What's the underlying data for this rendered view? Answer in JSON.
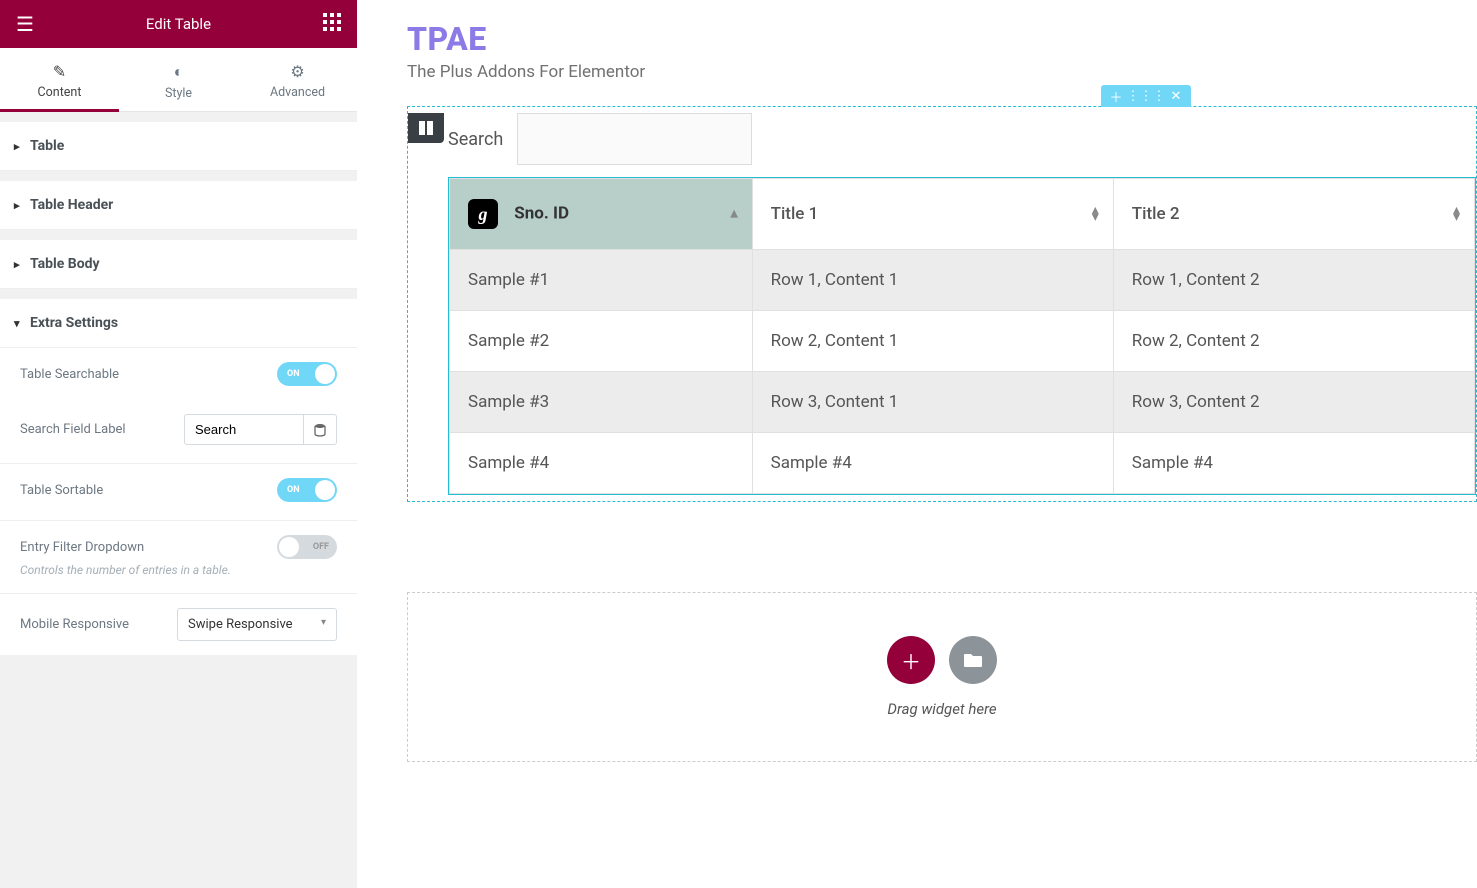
{
  "header": {
    "title": "Edit Table"
  },
  "tabs": [
    {
      "label": "Content",
      "icon": "✎",
      "active": true
    },
    {
      "label": "Style",
      "icon": "◐",
      "active": false
    },
    {
      "label": "Advanced",
      "icon": "⚙",
      "active": false
    }
  ],
  "panels": [
    {
      "label": "Table",
      "open": false
    },
    {
      "label": "Table Header",
      "open": false
    },
    {
      "label": "Table Body",
      "open": false
    },
    {
      "label": "Extra Settings",
      "open": true
    }
  ],
  "extra": {
    "searchable": {
      "label": "Table Searchable",
      "on": true
    },
    "searchLabel": {
      "label": "Search Field Label",
      "value": "Search"
    },
    "sortable": {
      "label": "Table Sortable",
      "on": true
    },
    "entryFilter": {
      "label": "Entry Filter Dropdown",
      "on": false,
      "help": "Controls the number of entries in a table."
    },
    "mobile": {
      "label": "Mobile Responsive",
      "value": "Swipe Responsive"
    }
  },
  "brand": {
    "title": "TPAE",
    "sub": "The Plus Addons For Elementor"
  },
  "preview": {
    "searchLabel": "Search",
    "columns": [
      {
        "label": "Sno. ID",
        "icon": true,
        "active": true
      },
      {
        "label": "Title 1",
        "icon": false,
        "active": false
      },
      {
        "label": "Title 2",
        "icon": false,
        "active": false
      }
    ],
    "rows": [
      [
        "Sample #1",
        "Row 1, Content 1",
        "Row 1, Content 2"
      ],
      [
        "Sample #2",
        "Row 2, Content 1",
        "Row 2, Content 2"
      ],
      [
        "Sample #3",
        "Row 3, Content 1",
        "Row 3, Content 2"
      ],
      [
        "Sample #4",
        "Sample #4",
        "Sample #4"
      ]
    ]
  },
  "dropzone": {
    "text": "Drag widget here"
  },
  "toggleLabels": {
    "on": "ON",
    "off": "OFF"
  }
}
